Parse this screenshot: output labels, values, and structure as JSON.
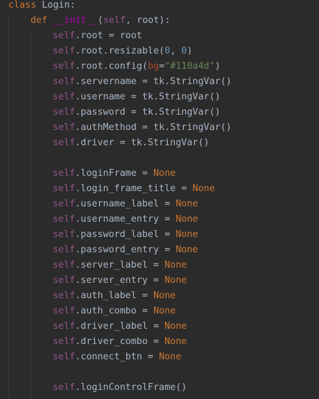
{
  "colors": {
    "background": "#2b2b2b",
    "keyword": "#cc7832",
    "default_text": "#a9b7c6",
    "magic_method": "#b200b2",
    "self": "#94558d",
    "number": "#6897bb",
    "named_param": "#aa4926",
    "string": "#6a8759"
  },
  "lines": [
    {
      "indent": 0,
      "tokens": [
        {
          "t": "class",
          "c": "kw"
        },
        {
          "t": " Login:",
          "c": "plain"
        }
      ]
    },
    {
      "indent": 1,
      "tokens": [
        {
          "t": "def",
          "c": "kw"
        },
        {
          "t": " ",
          "c": "plain"
        },
        {
          "t": "__init__",
          "c": "magic"
        },
        {
          "t": "(",
          "c": "plain"
        },
        {
          "t": "self",
          "c": "self"
        },
        {
          "t": ", root):",
          "c": "plain"
        }
      ]
    },
    {
      "indent": 2,
      "tokens": [
        {
          "t": "self",
          "c": "self"
        },
        {
          "t": ".root = root",
          "c": "plain"
        }
      ]
    },
    {
      "indent": 2,
      "tokens": [
        {
          "t": "self",
          "c": "self"
        },
        {
          "t": ".root.resizable(",
          "c": "plain"
        },
        {
          "t": "0",
          "c": "num"
        },
        {
          "t": ", ",
          "c": "plain"
        },
        {
          "t": "0",
          "c": "num"
        },
        {
          "t": ")",
          "c": "plain"
        }
      ]
    },
    {
      "indent": 2,
      "tokens": [
        {
          "t": "self",
          "c": "self"
        },
        {
          "t": ".root.config(",
          "c": "plain"
        },
        {
          "t": "bg",
          "c": "param"
        },
        {
          "t": "=",
          "c": "plain"
        },
        {
          "t": "\"#110a4d\"",
          "c": "str"
        },
        {
          "t": ")",
          "c": "plain"
        }
      ]
    },
    {
      "indent": 2,
      "tokens": [
        {
          "t": "self",
          "c": "self"
        },
        {
          "t": ".servername = tk.StringVar()",
          "c": "plain"
        }
      ]
    },
    {
      "indent": 2,
      "tokens": [
        {
          "t": "self",
          "c": "self"
        },
        {
          "t": ".username = tk.StringVar()",
          "c": "plain"
        }
      ]
    },
    {
      "indent": 2,
      "tokens": [
        {
          "t": "self",
          "c": "self"
        },
        {
          "t": ".password = tk.StringVar()",
          "c": "plain"
        }
      ]
    },
    {
      "indent": 2,
      "tokens": [
        {
          "t": "self",
          "c": "self"
        },
        {
          "t": ".authMethod = tk.StringVar()",
          "c": "plain"
        }
      ]
    },
    {
      "indent": 2,
      "tokens": [
        {
          "t": "self",
          "c": "self"
        },
        {
          "t": ".driver = tk.StringVar()",
          "c": "plain"
        }
      ]
    },
    {
      "indent": 2,
      "tokens": []
    },
    {
      "indent": 2,
      "tokens": [
        {
          "t": "self",
          "c": "self"
        },
        {
          "t": ".loginFrame = ",
          "c": "plain"
        },
        {
          "t": "None",
          "c": "none"
        }
      ]
    },
    {
      "indent": 2,
      "tokens": [
        {
          "t": "self",
          "c": "self"
        },
        {
          "t": ".login_frame_title = ",
          "c": "plain"
        },
        {
          "t": "None",
          "c": "none"
        }
      ]
    },
    {
      "indent": 2,
      "tokens": [
        {
          "t": "self",
          "c": "self"
        },
        {
          "t": ".username_label = ",
          "c": "plain"
        },
        {
          "t": "None",
          "c": "none"
        }
      ]
    },
    {
      "indent": 2,
      "tokens": [
        {
          "t": "self",
          "c": "self"
        },
        {
          "t": ".username_entry = ",
          "c": "plain"
        },
        {
          "t": "None",
          "c": "none"
        }
      ]
    },
    {
      "indent": 2,
      "tokens": [
        {
          "t": "self",
          "c": "self"
        },
        {
          "t": ".password_label = ",
          "c": "plain"
        },
        {
          "t": "None",
          "c": "none"
        }
      ]
    },
    {
      "indent": 2,
      "tokens": [
        {
          "t": "self",
          "c": "self"
        },
        {
          "t": ".password_entry = ",
          "c": "plain"
        },
        {
          "t": "None",
          "c": "none"
        }
      ]
    },
    {
      "indent": 2,
      "tokens": [
        {
          "t": "self",
          "c": "self"
        },
        {
          "t": ".server_label = ",
          "c": "plain"
        },
        {
          "t": "None",
          "c": "none"
        }
      ]
    },
    {
      "indent": 2,
      "tokens": [
        {
          "t": "self",
          "c": "self"
        },
        {
          "t": ".server_entry = ",
          "c": "plain"
        },
        {
          "t": "None",
          "c": "none"
        }
      ]
    },
    {
      "indent": 2,
      "tokens": [
        {
          "t": "self",
          "c": "self"
        },
        {
          "t": ".auth_label = ",
          "c": "plain"
        },
        {
          "t": "None",
          "c": "none"
        }
      ]
    },
    {
      "indent": 2,
      "tokens": [
        {
          "t": "self",
          "c": "self"
        },
        {
          "t": ".auth_combo = ",
          "c": "plain"
        },
        {
          "t": "None",
          "c": "none"
        }
      ]
    },
    {
      "indent": 2,
      "tokens": [
        {
          "t": "self",
          "c": "self"
        },
        {
          "t": ".driver_label = ",
          "c": "plain"
        },
        {
          "t": "None",
          "c": "none"
        }
      ]
    },
    {
      "indent": 2,
      "tokens": [
        {
          "t": "self",
          "c": "self"
        },
        {
          "t": ".driver_combo = ",
          "c": "plain"
        },
        {
          "t": "None",
          "c": "none"
        }
      ]
    },
    {
      "indent": 2,
      "tokens": [
        {
          "t": "self",
          "c": "self"
        },
        {
          "t": ".connect_btn = ",
          "c": "plain"
        },
        {
          "t": "None",
          "c": "none"
        }
      ]
    },
    {
      "indent": 2,
      "tokens": []
    },
    {
      "indent": 2,
      "tokens": [
        {
          "t": "self",
          "c": "self"
        },
        {
          "t": ".loginControlFrame()",
          "c": "plain"
        }
      ]
    }
  ]
}
